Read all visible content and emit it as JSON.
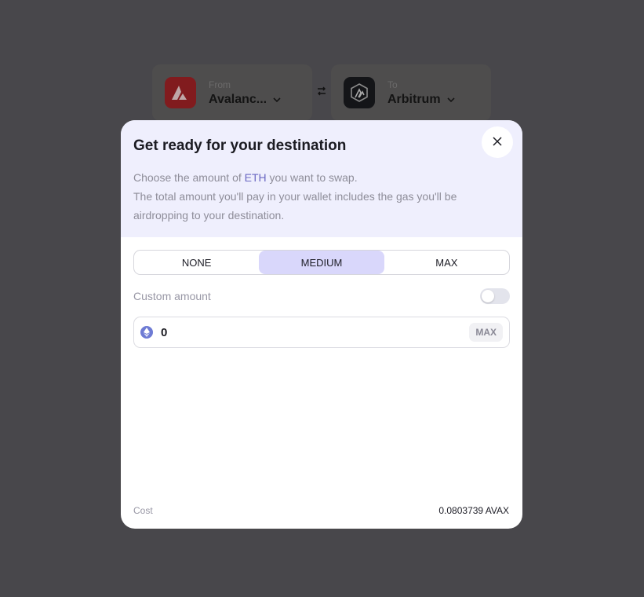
{
  "bridge": {
    "from_label": "From",
    "from_chain": "Avalanc...",
    "to_label": "To",
    "to_chain": "Arbitrum"
  },
  "modal": {
    "title": "Get ready for your destination",
    "desc_prefix": "Choose the amount of ",
    "desc_token": "ETH",
    "desc_suffix": " you want to swap.",
    "desc_line2": "The total amount you'll pay in your wallet includes the gas you'll be airdropping to your destination.",
    "options": [
      {
        "label": "NONE"
      },
      {
        "label": "MEDIUM"
      },
      {
        "label": "MAX"
      }
    ],
    "selected_option": "MEDIUM",
    "custom_label": "Custom amount",
    "custom_enabled": false,
    "amount_value": "0",
    "max_label": "MAX",
    "cost_label": "Cost",
    "cost_value": "0.0803739 AVAX"
  },
  "colors": {
    "accent": "#6a67c2",
    "selected_bg": "#d9d7fb",
    "header_bg": "#efeffd"
  },
  "icons": {
    "from_chain": "avalanche-icon",
    "to_chain": "arbitrum-icon",
    "swap": "swap-arrows-icon",
    "close": "close-icon",
    "token": "ethereum-icon"
  }
}
